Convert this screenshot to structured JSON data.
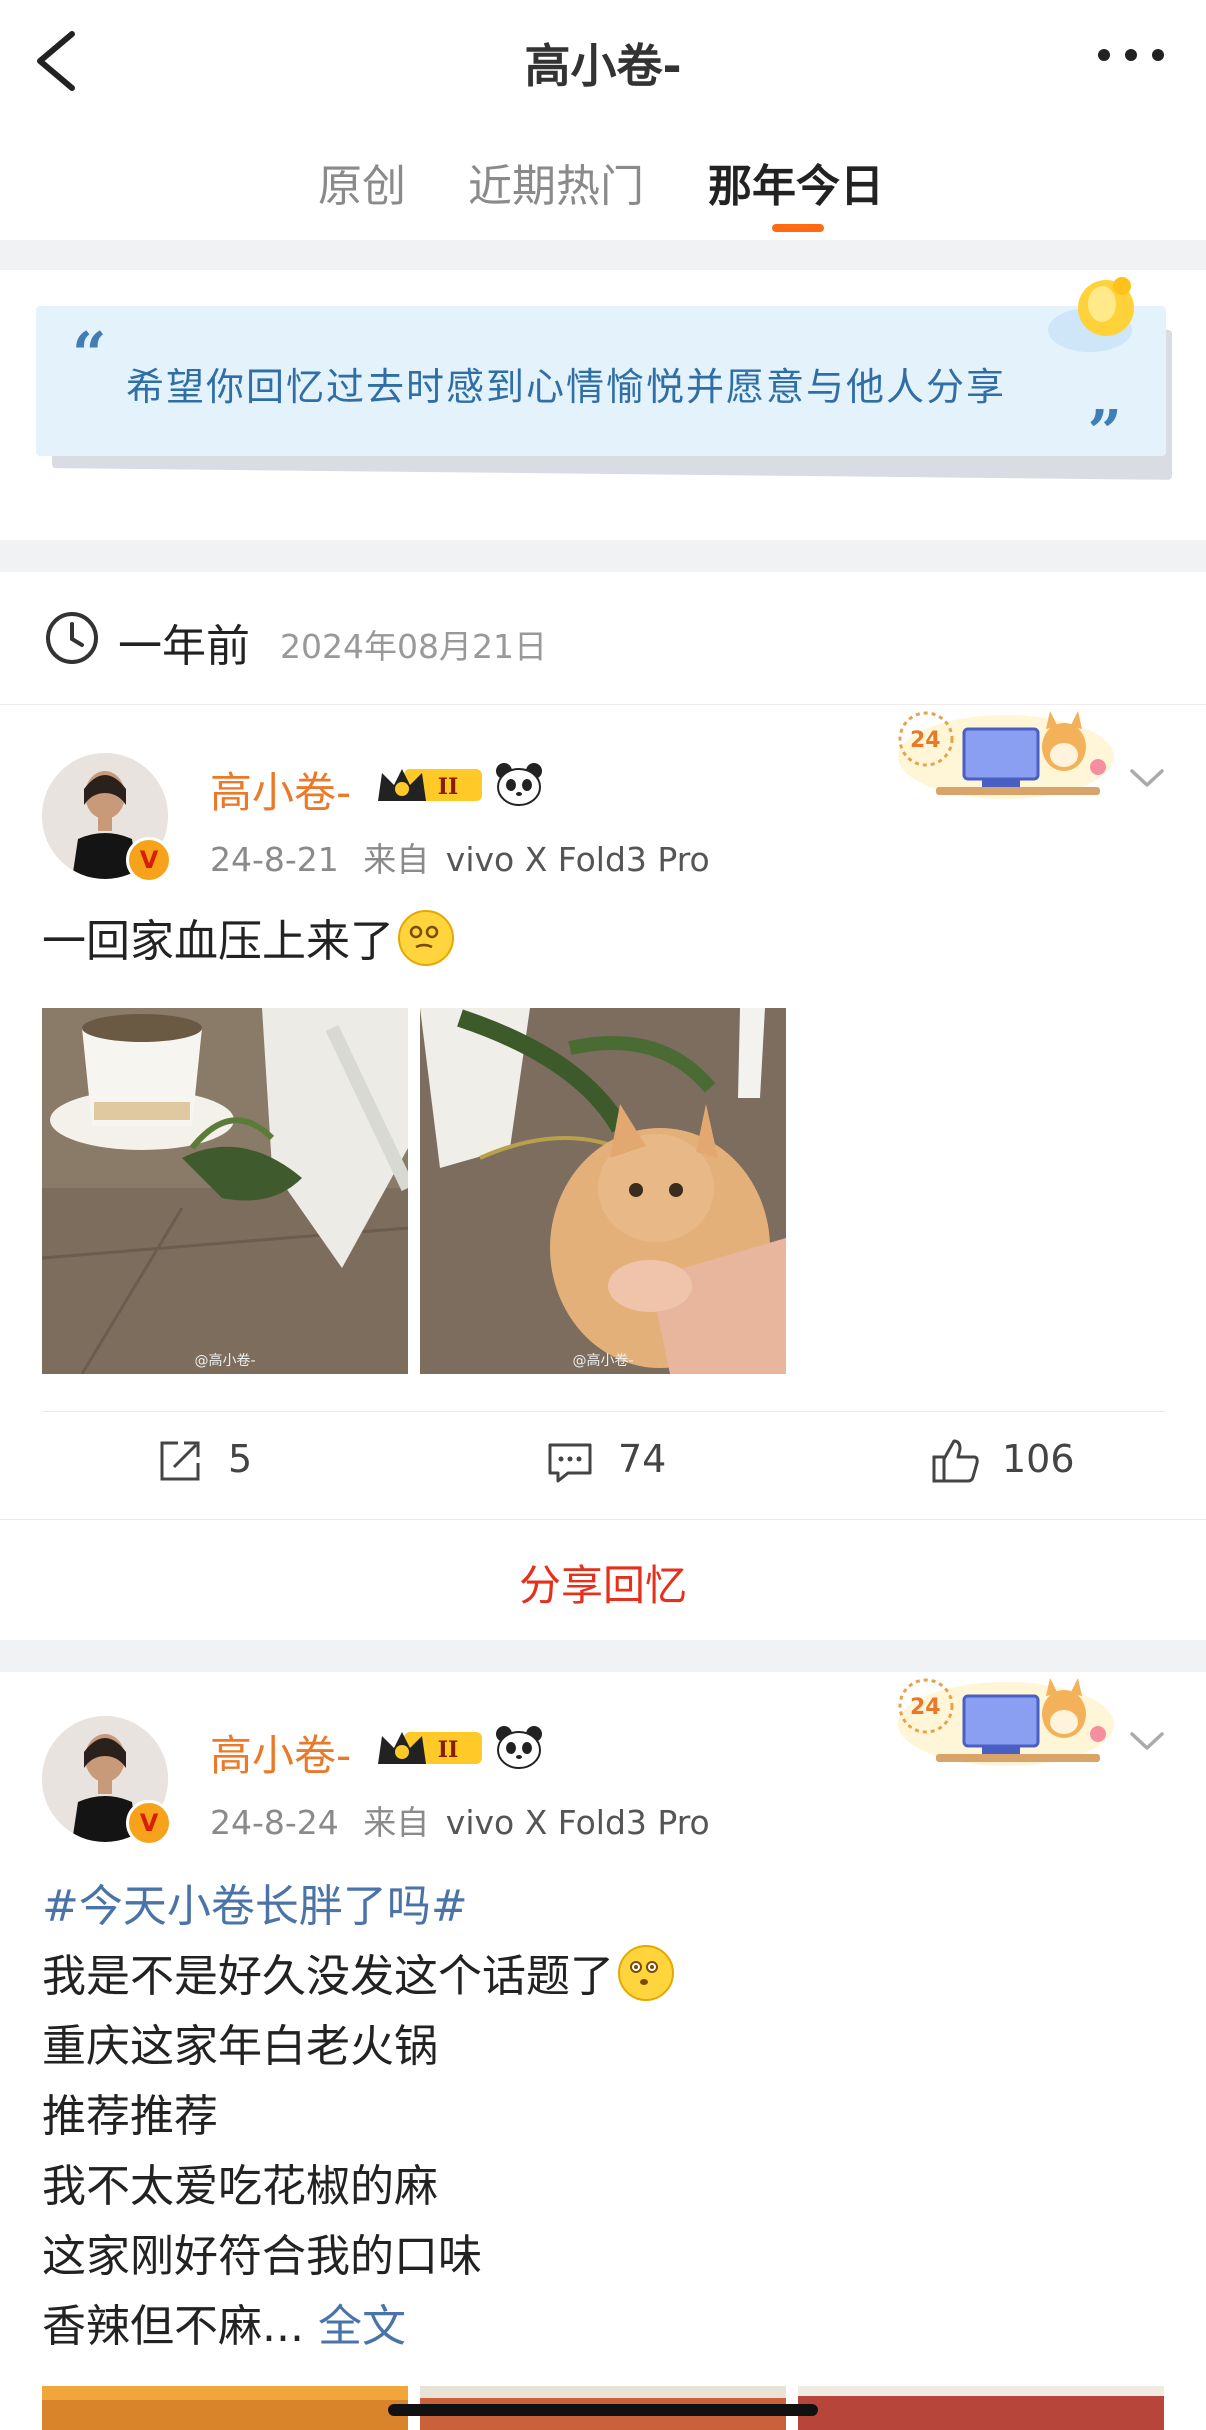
{
  "header": {
    "title": "高小卷-"
  },
  "tabs": [
    {
      "label": "原创",
      "active": false
    },
    {
      "label": "近期热门",
      "active": false
    },
    {
      "label": "那年今日",
      "active": true
    }
  ],
  "accent_color": "#ff6a13",
  "banner": {
    "text": "希望你回忆过去时感到心情愉悦并愿意与他人分享"
  },
  "section": {
    "label": "一年前",
    "date": "2024年08月21日"
  },
  "posts": [
    {
      "name": "高小卷-",
      "meta_date": "24-8-21",
      "meta_from": "来自",
      "meta_device": "vivo X Fold3 Pro",
      "text": "一回家血压上来了",
      "images": [
        {
          "watermark": "@高小卷-"
        },
        {
          "watermark": "@高小卷-"
        }
      ],
      "actions": {
        "repost": "5",
        "comments": "74",
        "likes": "106"
      },
      "share_label": "分享回忆"
    },
    {
      "name": "高小卷-",
      "meta_date": "24-8-24",
      "meta_from": "来自",
      "meta_device": "vivo X Fold3 Pro",
      "hashtag": "#今天小卷长胖了吗#",
      "lines": [
        "我是不是好久没发这个话题了",
        "重庆这家年白老火锅",
        "推荐推荐",
        "我不太爱吃花椒的麻",
        "这家刚好符合我的口味",
        "香辣但不麻..."
      ],
      "full_text_link": "全文"
    }
  ],
  "sticker_text": "24"
}
